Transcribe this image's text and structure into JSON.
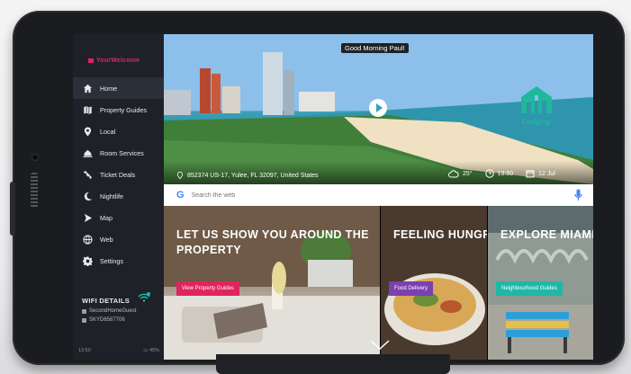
{
  "sidebar": {
    "brand": "YourWelcome",
    "items": [
      {
        "label": "Home",
        "icon": "home-icon"
      },
      {
        "label": "Property Guides",
        "icon": "map-book-icon"
      },
      {
        "label": "Local",
        "icon": "location-pin-icon"
      },
      {
        "label": "Room Services",
        "icon": "cloche-icon"
      },
      {
        "label": "Ticket Deals",
        "icon": "ticket-icon"
      },
      {
        "label": "Nightlife",
        "icon": "moon-icon"
      },
      {
        "label": "Map",
        "icon": "navigation-arrow-icon"
      },
      {
        "label": "Web",
        "icon": "globe-icon"
      },
      {
        "label": "Settings",
        "icon": "gear-icon"
      }
    ],
    "wifi": {
      "title": "WIFI DETAILS",
      "network": "SecondHomeGuest",
      "password": "SKYD6587706"
    },
    "status": {
      "time": "13:50",
      "battery": "45%"
    }
  },
  "hero": {
    "greeting": "Good Morning Paul!",
    "logo_text": "Lodging",
    "address": "852374 US-17, Yulee, FL 32097, United States",
    "temperature": "25°",
    "time": "13:50",
    "date": "12 Jul"
  },
  "search": {
    "placeholder": "Search the web"
  },
  "cards": [
    {
      "title": "LET US SHOW YOU AROUND THE PROPERTY",
      "button": "View Property Guides",
      "color": "#e0245e"
    },
    {
      "title": "FEELING HUNGRY?",
      "button": "Food Delivery",
      "color": "#7b3fb0"
    },
    {
      "title": "EXPLORE MIAMI",
      "button": "Neighbourhood Guides",
      "color": "#1fb8a8"
    }
  ],
  "colors": {
    "accent": "#e0245e",
    "sidebar_bg": "#1e2228",
    "logo": "#1fb89a"
  }
}
